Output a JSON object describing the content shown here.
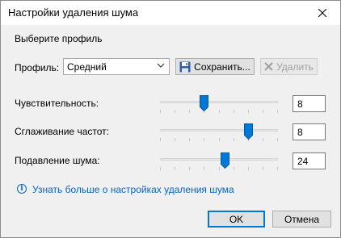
{
  "window": {
    "title": "Настройки удаления шума"
  },
  "profile_section": {
    "heading": "Выберите профиль",
    "label": "Профиль:",
    "selected": "Средний",
    "save_label": "Сохранить...",
    "delete_label": "Удалить"
  },
  "sliders": [
    {
      "label": "Чувствительность:",
      "value": "8",
      "level": 0.375
    },
    {
      "label": "Сглаживание частот:",
      "value": "8",
      "level": 0.75
    },
    {
      "label": "Подавление шума:",
      "value": "24",
      "level": 0.55
    }
  ],
  "info": {
    "icon": "info-icon",
    "text": "Узнать больше о настройках удаления шума"
  },
  "footer": {
    "ok_label": "OK",
    "cancel_label": "Отмена"
  },
  "colors": {
    "accent": "#0078d7",
    "link": "#0066cc",
    "dialog_bg": "#f0f0f0"
  }
}
